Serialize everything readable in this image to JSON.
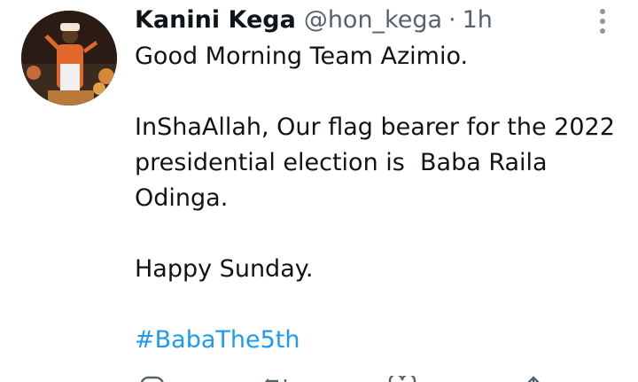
{
  "author": {
    "name": "Kanini Kega",
    "handle": "@hon_kega",
    "separator": "·",
    "time": "1h"
  },
  "tweet": {
    "line1": "Good Morning Team Azimio.",
    "line2": "InShaAllah, Our flag bearer for the 2022 presidential election is  Baba Raila Odinga.",
    "line3": "Happy Sunday.",
    "hashtag": "#BabaThe5th"
  },
  "colors": {
    "text": "#0f1419",
    "muted": "#536471",
    "link": "#1d9bf0"
  },
  "icons": [
    "more-icon",
    "reply-icon",
    "retweet-icon",
    "like-icon",
    "share-icon"
  ]
}
